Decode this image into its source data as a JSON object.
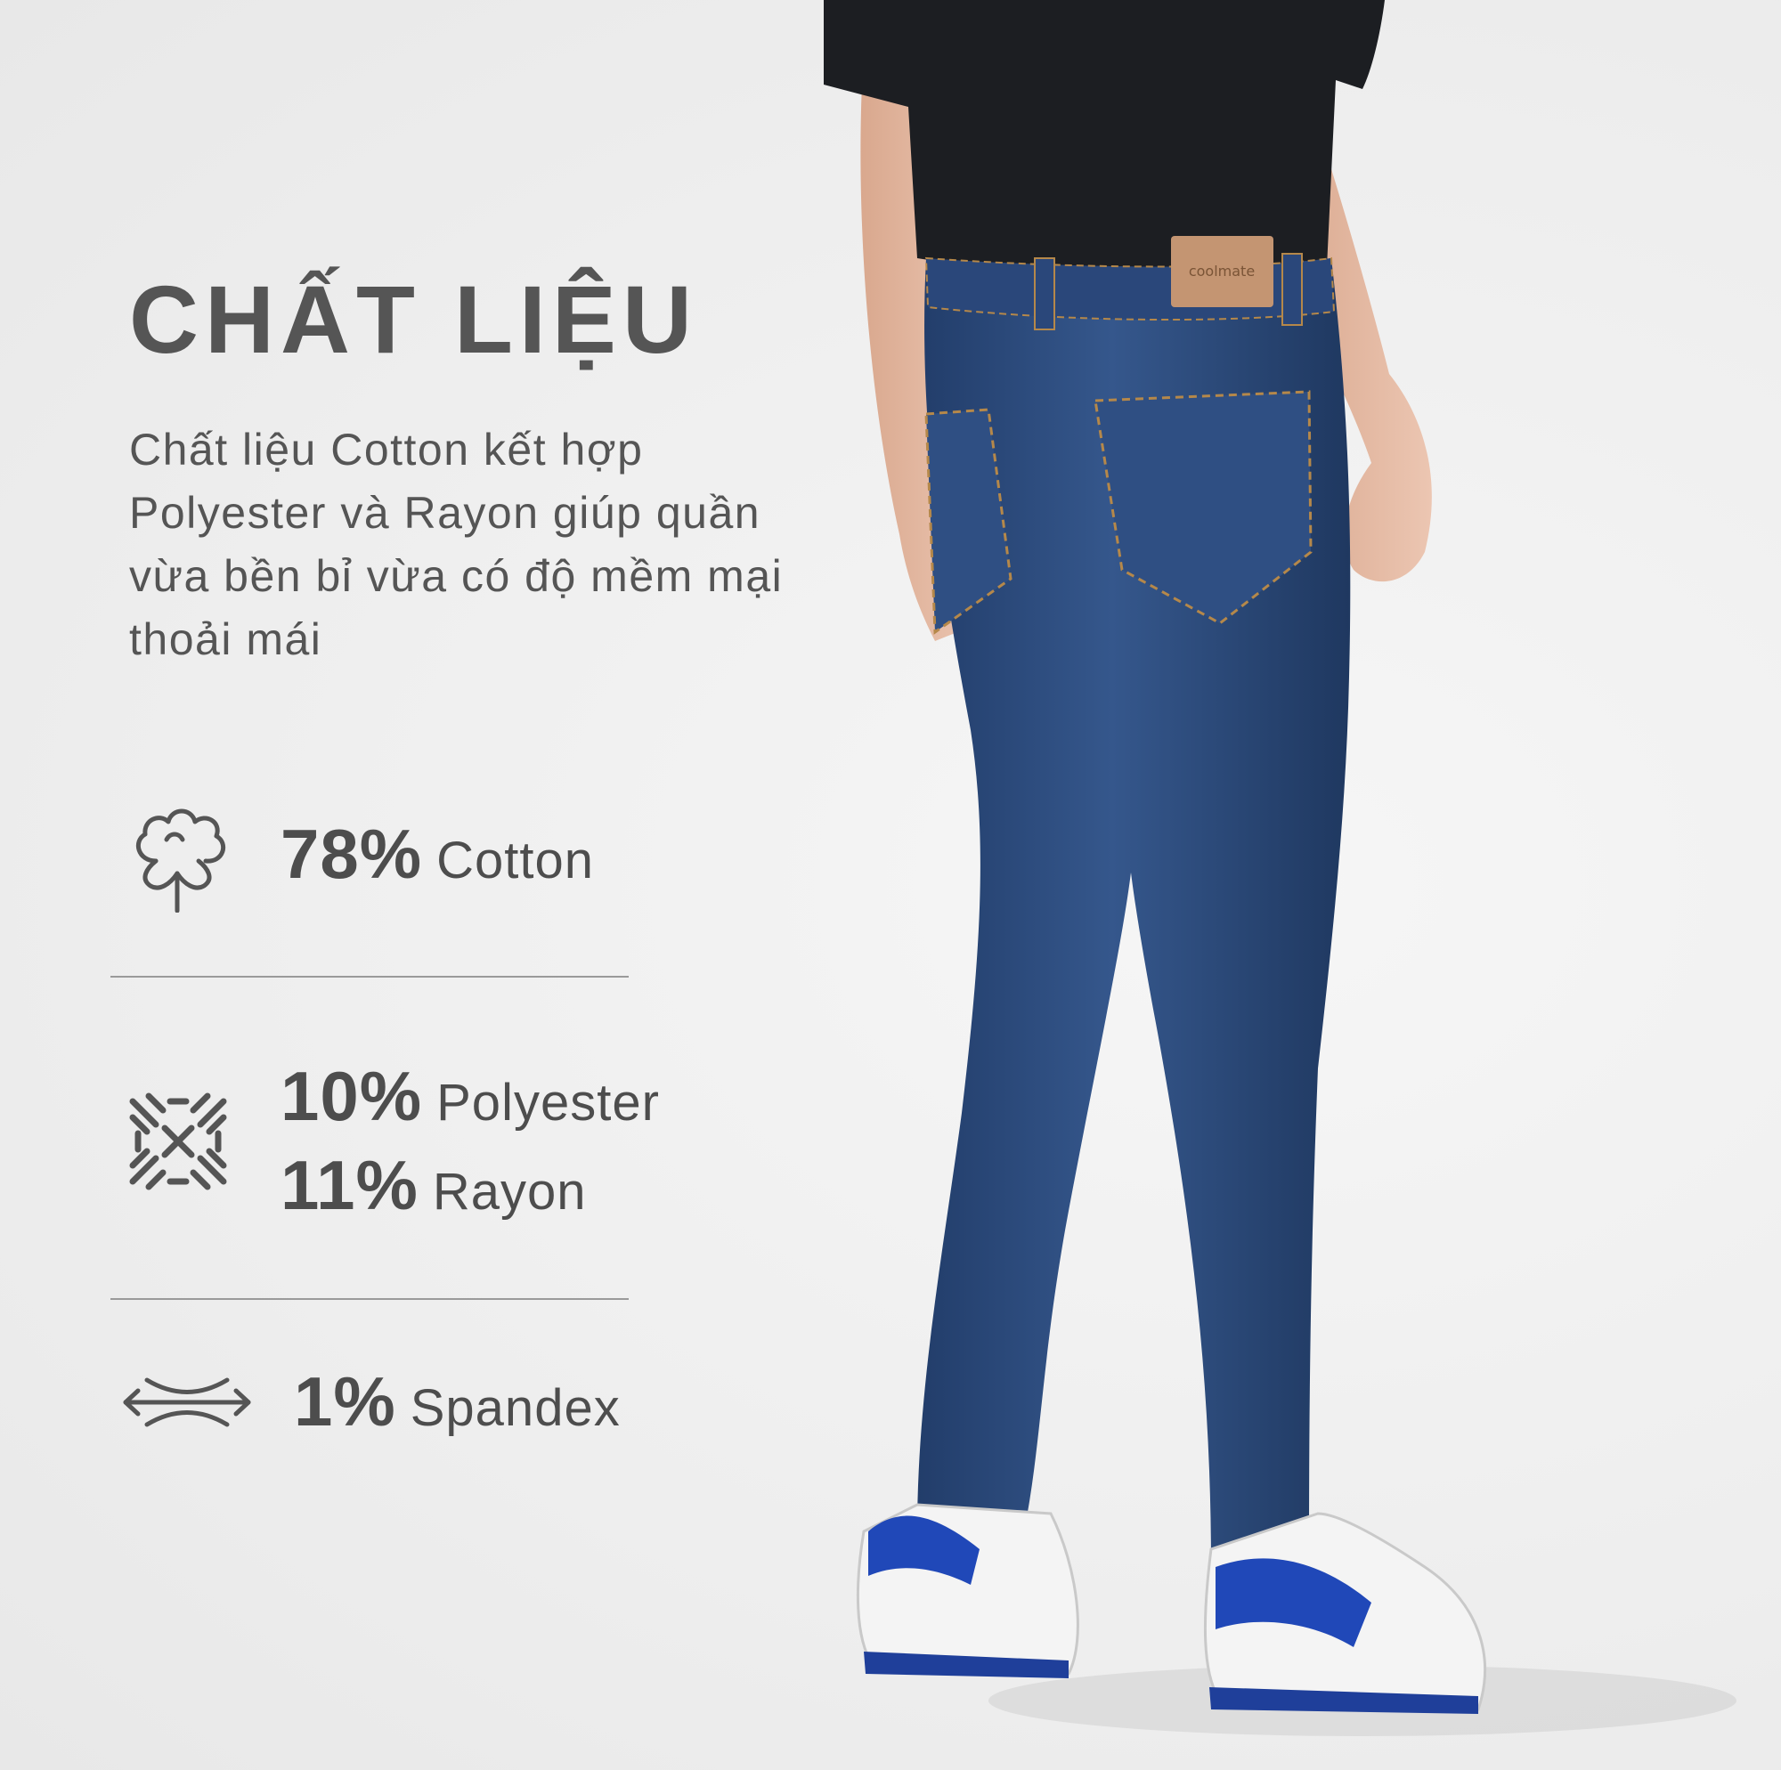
{
  "title": "CHẤT LIỆU",
  "description": [
    "Chất liệu Cotton kết hợp",
    "Polyester và Rayon giúp quần",
    "vừa bền bỉ vừa có độ mềm mại",
    "thoải mái"
  ],
  "materials": [
    {
      "icon": "cotton-flower-icon",
      "percent": "78%",
      "name": "Cotton"
    },
    {
      "icon": "woven-fabric-icon",
      "percent": "10%",
      "name": "Polyester"
    },
    {
      "icon": "woven-fabric-icon",
      "percent": "11%",
      "name": "Rayon"
    },
    {
      "icon": "stretch-arrows-icon",
      "percent": "1%",
      "name": "Spandex"
    }
  ],
  "photo": {
    "label_text": "coolmate",
    "colors": {
      "denim": "#2c4a7c",
      "shirt": "#1c1e22",
      "shoe_accent": "#2048b8",
      "skin": "#e3b8a0"
    }
  }
}
